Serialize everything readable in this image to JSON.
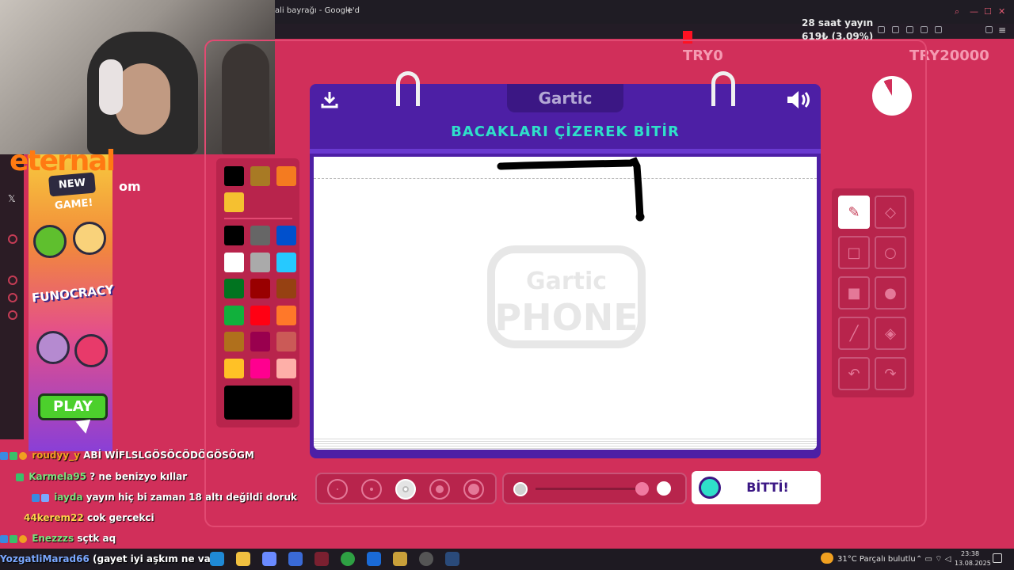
{
  "browser": {
    "tab_title": "ali bayrağı - Google'd",
    "new_tab": "+"
  },
  "stream": {
    "uptime": "28 saat yayın",
    "donation": "619₺ (3.09%)",
    "goal_start": "TRY0",
    "goal_end": "TRY20000",
    "donation_fraction": 0.0309
  },
  "brand": {
    "name": "eternal",
    "suffix": "om"
  },
  "ad": {
    "badge": "NEW GAME!",
    "title": "FUNOCRACY",
    "play": "PLAY"
  },
  "chat": [
    {
      "user": "roudyy_y",
      "message": "ABİ WİFLSLGÖSÖCÖDÖGÖSÖGM",
      "user_color": "#f0a020"
    },
    {
      "user": "Karmela95",
      "message": "? ne benizyo kıllar",
      "user_color": "#7ee07e"
    },
    {
      "user": "iayda",
      "message": "yayın hiç bi zaman 18 altı değildi doruk",
      "user_color": "#7ee07e"
    },
    {
      "user": "44kerem22",
      "message": "cok gercekci",
      "user_color": "#ffd24a"
    },
    {
      "user": "Enezzzs",
      "message": "sçtk aq",
      "user_color": "#7ee07e"
    },
    {
      "user": "YozgatliMarad66",
      "message": "(gayet iyi aşkım ne var)",
      "user_color": "#7aa8ff"
    }
  ],
  "game": {
    "logo": "Gartic",
    "prompt": "BACAKLARI ÇİZEREK BİTİR",
    "done_button": "BİTTİ!",
    "watermark_top": "Gartic",
    "watermark_bottom": "PHONE",
    "current_color": "#000000",
    "palette_top": [
      "#000000",
      "#a87a24",
      "#f47b20",
      "#f5c030"
    ],
    "palette_main": [
      "#000000",
      "#666666",
      "#0050cd",
      "#ffffff",
      "#aaaaaa",
      "#26c9ff",
      "#017420",
      "#990000",
      "#964112",
      "#11b03c",
      "#ff0013",
      "#ff7829",
      "#b0701c",
      "#99004e",
      "#cb5a57",
      "#ffc126",
      "#ff008f",
      "#feafa8"
    ],
    "tools": [
      "pencil-icon",
      "eraser-icon",
      "rectangle-outline-icon",
      "circle-outline-icon",
      "rectangle-fill-icon",
      "circle-fill-icon",
      "line-icon",
      "fill-bucket-icon",
      "undo-icon",
      "redo-icon"
    ],
    "brush_sizes": 5,
    "selected_size_index": 2
  },
  "taskbar": {
    "weather": "31°C  Parçalı bulutlu",
    "time": "23:38",
    "date": "13.08.2025"
  }
}
